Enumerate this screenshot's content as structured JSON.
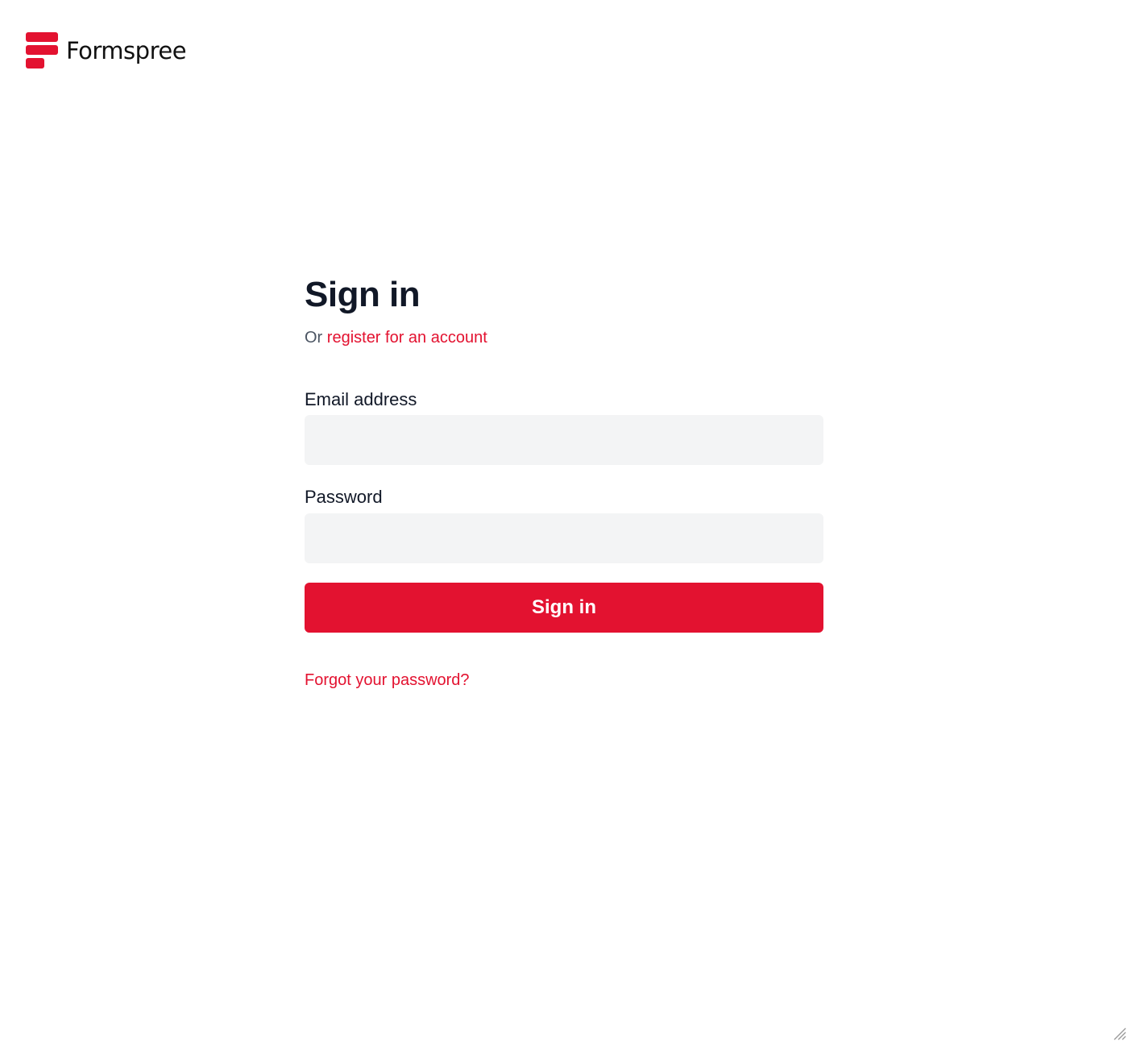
{
  "brand": {
    "name": "Formspree",
    "logo_icon": "formspree-stacked-bars-logo",
    "color": "#e31230"
  },
  "signin": {
    "title": "Sign in",
    "subtitle_prefix": "Or",
    "register_link": "register for an account",
    "email_label": "Email address",
    "email_value": "",
    "password_label": "Password",
    "password_value": "",
    "submit_label": "Sign in",
    "forgot_link": "Forgot your password?"
  },
  "window": {
    "resize_icon": "resize-grip-icon"
  }
}
